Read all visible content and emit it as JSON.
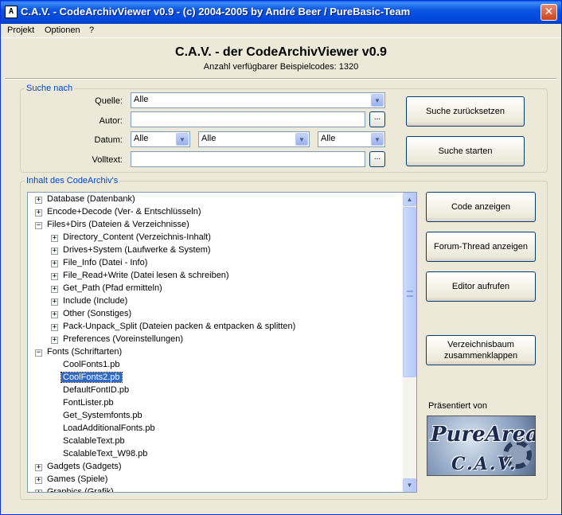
{
  "window": {
    "app_icon_text": "A",
    "title": "C.A.V. - CodeArchivViewer v0.9 - (c) 2004-2005 by André Beer / PureBasic-Team",
    "close_glyph": "✕"
  },
  "menu": {
    "items": [
      {
        "label": "Projekt"
      },
      {
        "label": "Optionen"
      },
      {
        "label": "?"
      }
    ]
  },
  "header": {
    "title": "C.A.V. - der CodeArchivViewer v0.9",
    "subtitle": "Anzahl verfügbarer Beispielcodes: 1320"
  },
  "search": {
    "group_label": "Suche nach",
    "quelle_label": "Quelle:",
    "quelle_value": "Alle",
    "autor_label": "Autor:",
    "autor_value": "",
    "datum_label": "Datum:",
    "datum_values": [
      "Alle",
      "Alle",
      "Alle"
    ],
    "volltext_label": "Volltext:",
    "volltext_value": "",
    "browse_glyph": "...",
    "dropdown_glyph": "▼",
    "reset_button": "Suche zurücksetzen",
    "start_button": "Suche starten"
  },
  "archive": {
    "group_label": "Inhalt des CodeArchiv's",
    "tree_items": [
      {
        "label": "Database  (Datenbank)",
        "level": 0,
        "expander": "+"
      },
      {
        "label": "Encode+Decode  (Ver- & Entschlüsseln)",
        "level": 0,
        "expander": "+"
      },
      {
        "label": "Files+Dirs  (Dateien & Verzeichnisse)",
        "level": 0,
        "expander": "−"
      },
      {
        "label": "Directory_Content (Verzeichnis-Inhalt)",
        "level": 1,
        "expander": "+"
      },
      {
        "label": "Drives+System (Laufwerke & System)",
        "level": 1,
        "expander": "+"
      },
      {
        "label": "File_Info (Datei - Info)",
        "level": 1,
        "expander": "+"
      },
      {
        "label": "File_Read+Write (Datei lesen & schreiben)",
        "level": 1,
        "expander": "+"
      },
      {
        "label": "Get_Path (Pfad ermitteln)",
        "level": 1,
        "expander": "+"
      },
      {
        "label": "Include (Include)",
        "level": 1,
        "expander": "+"
      },
      {
        "label": "Other (Sonstiges)",
        "level": 1,
        "expander": "+"
      },
      {
        "label": "Pack-Unpack_Split (Dateien packen & entpacken & splitten)",
        "level": 1,
        "expander": "+"
      },
      {
        "label": "Preferences (Voreinstellungen)",
        "level": 1,
        "expander": "+"
      },
      {
        "label": "Fonts  (Schriftarten)",
        "level": 0,
        "expander": "−"
      },
      {
        "label": "CoolFonts1.pb",
        "level": 1,
        "expander": ""
      },
      {
        "label": "CoolFonts2.pb",
        "level": 1,
        "expander": "",
        "selected": true
      },
      {
        "label": "DefaultFontID.pb",
        "level": 1,
        "expander": ""
      },
      {
        "label": "FontLister.pb",
        "level": 1,
        "expander": ""
      },
      {
        "label": "Get_Systemfonts.pb",
        "level": 1,
        "expander": ""
      },
      {
        "label": "LoadAdditionalFonts.pb",
        "level": 1,
        "expander": ""
      },
      {
        "label": "ScalableText.pb",
        "level": 1,
        "expander": ""
      },
      {
        "label": "ScalableText_W98.pb",
        "level": 1,
        "expander": ""
      },
      {
        "label": "Gadgets  (Gadgets)",
        "level": 0,
        "expander": "+"
      },
      {
        "label": "Games  (Spiele)",
        "level": 0,
        "expander": "+"
      },
      {
        "label": "Graphics  (Grafik)",
        "level": 0,
        "expander": "+"
      }
    ],
    "scroll_up_glyph": "▲",
    "scroll_down_glyph": "▼"
  },
  "actions": {
    "show_code": "Code anzeigen",
    "show_forum": "Forum-Thread anzeigen",
    "open_editor": "Editor aufrufen",
    "collapse_tree": "Verzeichnisbaum zusammenklappen"
  },
  "presented": {
    "label": "Präsentiert von",
    "logo_text": "PureArea.net",
    "logo_sub": "C.A.V."
  }
}
